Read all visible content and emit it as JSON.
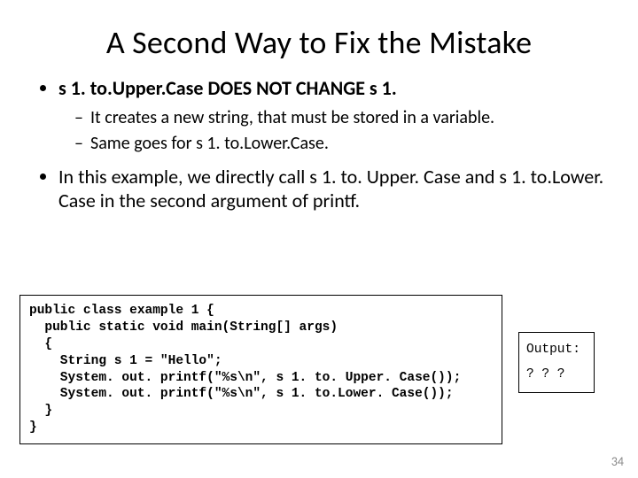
{
  "title": "A Second Way to Fix the Mistake",
  "bullets": {
    "b1": "s 1. to.Upper.Case DOES NOT CHANGE s 1.",
    "sub1": " It creates a new string, that must be stored in a variable.",
    "sub2": "Same goes for s 1. to.Lower.Case.",
    "b2": "In this example, we directly call s 1. to. Upper. Case and s 1. to.Lower. Case in the second argument of printf."
  },
  "code": "public class example 1 {\n  public static void main(String[] args)\n  {\n    String s 1 = \"Hello\";\n    System. out. printf(\"%s\\n\", s 1. to. Upper. Case());\n    System. out. printf(\"%s\\n\", s 1. to.Lower. Case());\n  }\n}",
  "output": {
    "label": "Output:",
    "value": "? ? ?"
  },
  "page_number": "34"
}
